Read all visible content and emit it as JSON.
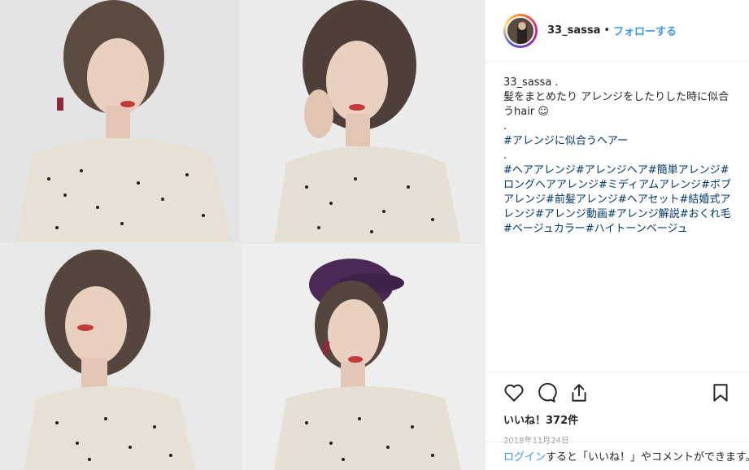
{
  "post": {
    "username": "33_sassa",
    "separator": "•",
    "follow_label": "フォローする"
  },
  "caption": {
    "author": "33_sassa .",
    "lines": [
      "髪をまとめたり アレンジをしたりした時に似合うhair ☺︎",
      ".",
      "",
      "#アレンジに似合うヘアー",
      "."
    ],
    "hashtags": "#ヘアアレンジ#アレンジヘア#簡単アレンジ#ロングヘアアレンジ#ミディアムアレンジ#ボブアレンジ#前髪アレンジ#ヘアセット#結婚式アレンジ#アレンジ動画#アレンジ解説#おくれ毛#ベージュカラー#ハイトーンベージュ"
  },
  "actions": {
    "icons": [
      "heart-icon",
      "comment-icon",
      "share-icon",
      "bookmark-icon"
    ],
    "likes": "いいね！372件",
    "date": "2018年11月24日"
  },
  "footer": {
    "login_link": "ログイン",
    "login_text": "すると「いいね！」やコメントができます。"
  },
  "colors": {
    "link_blue": "#3897f0",
    "hashtag": "#003569",
    "text": "#262626",
    "muted": "#999999"
  }
}
